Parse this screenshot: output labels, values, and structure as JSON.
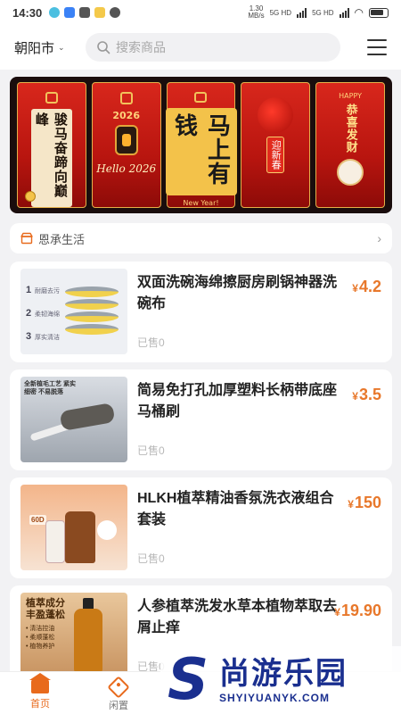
{
  "status_bar": {
    "time": "14:30",
    "speed": "1.30\nMB/s",
    "net1": "5G HD",
    "net2": "5G HD"
  },
  "header": {
    "city": "朝阳市",
    "search_placeholder": "搜索商品"
  },
  "banner": {
    "panel1_text": "骏马奋蹄向巅峰",
    "panel2_year": "2026",
    "panel2_script": "Hello 2026",
    "panel3_text": "马上有钱",
    "panel3_small": "New Year!",
    "panel4_tag": "迎新春",
    "panel5_top": "HAPPY",
    "panel5_text": "恭喜发财"
  },
  "store": {
    "name": "恩承生活"
  },
  "products": [
    {
      "name": "双面洗碗海绵擦厨房刷锅神器洗碗布",
      "price": "4.2",
      "sold": "已售0",
      "thumb": {
        "labels": [
          "耐磨去污",
          "柔韧海绵",
          "厚实清洁"
        ],
        "nums": [
          "1",
          "2",
          "3"
        ]
      }
    },
    {
      "name": "简易免打孔加厚塑料长柄带底座马桶刷",
      "price": "3.5",
      "sold": "已售0",
      "thumb": {
        "caption": "全新植毛工艺 紧实细密 不易脱落"
      }
    },
    {
      "name": "HLKH植萃精油香氛洗衣液组合套装",
      "price": "150",
      "sold": "已售0",
      "thumb": {
        "badge": "60D"
      }
    },
    {
      "name": "人参植萃洗发水草本植物萃取去屑止痒",
      "price": "19.90",
      "sold": "已售0",
      "thumb": {
        "title": "植萃成分 丰盈蓬松",
        "points": "• 清洁控油\n• 柔顺蓬松\n• 植物养护"
      }
    }
  ],
  "currency": "¥",
  "bottom_nav": {
    "home": "首页",
    "idle": "闲置"
  },
  "watermark": {
    "logo": "S",
    "cn": "尚游乐园",
    "en": "SHYIYUANYK.COM"
  },
  "colors": {
    "accent": "#e86a1c",
    "price": "#e8782b",
    "watermark": "#1a2f8f"
  }
}
